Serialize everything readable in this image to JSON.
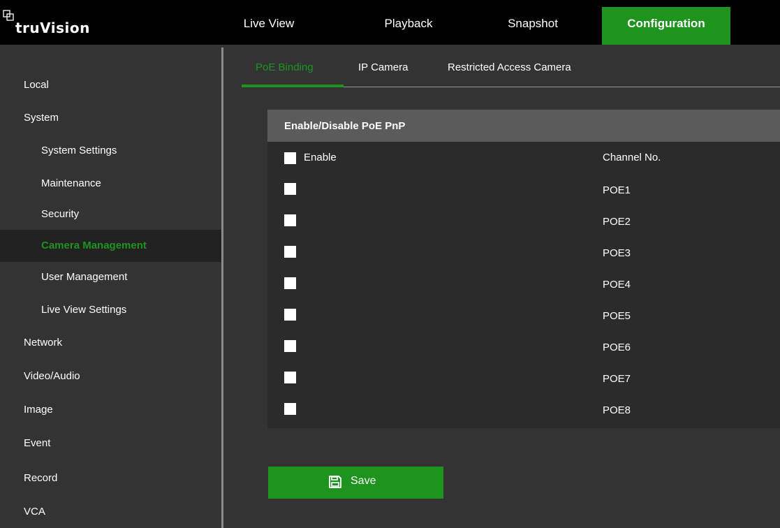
{
  "app": {
    "brand": "truVision"
  },
  "topnav": {
    "tabs": [
      {
        "label": "Live View"
      },
      {
        "label": "Playback"
      },
      {
        "label": "Snapshot"
      },
      {
        "label": "Configuration",
        "active": true
      }
    ]
  },
  "sidebar": {
    "items": [
      {
        "label": "Local"
      },
      {
        "label": "System"
      },
      {
        "label": "System Settings"
      },
      {
        "label": "Maintenance"
      },
      {
        "label": "Security"
      },
      {
        "label": "Camera Management",
        "active": true
      },
      {
        "label": "User Management"
      },
      {
        "label": "Live View Settings"
      },
      {
        "label": "Network"
      },
      {
        "label": "Video/Audio"
      },
      {
        "label": "Image"
      },
      {
        "label": "Event"
      },
      {
        "label": "Record"
      },
      {
        "label": "VCA"
      }
    ]
  },
  "subtabs": [
    {
      "label": "PoE Binding",
      "active": true
    },
    {
      "label": "IP Camera"
    },
    {
      "label": "Restricted Access Camera"
    }
  ],
  "poe_table": {
    "section_title": "Enable/Disable PoE PnP",
    "enable_label": "Enable",
    "channel_header": "Channel No.",
    "header_checked": false,
    "rows": [
      {
        "channel": "POE1",
        "checked": false
      },
      {
        "channel": "POE2",
        "checked": false
      },
      {
        "channel": "POE3",
        "checked": false
      },
      {
        "channel": "POE4",
        "checked": false
      },
      {
        "channel": "POE5",
        "checked": false
      },
      {
        "channel": "POE6",
        "checked": false
      },
      {
        "channel": "POE7",
        "checked": false
      },
      {
        "channel": "POE8",
        "checked": false
      }
    ]
  },
  "actions": {
    "save_label": "Save",
    "save_icon": "floppy-disk-icon"
  },
  "colors": {
    "accent": "#1e931e",
    "topbar": "#000000",
    "background": "#333333",
    "panel": "#2b2b2b",
    "panel_header": "#5b5b5b",
    "active_sidebar_bg": "#212121"
  }
}
